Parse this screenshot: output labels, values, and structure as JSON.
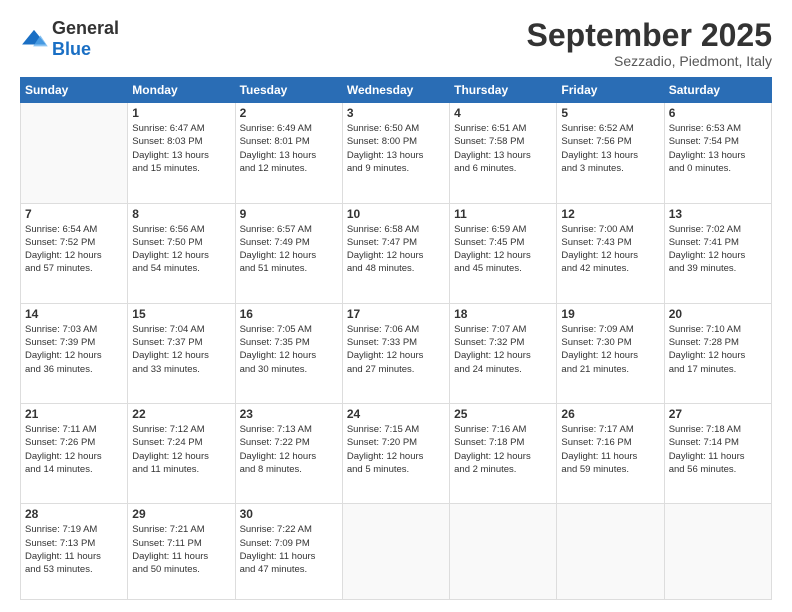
{
  "header": {
    "logo_general": "General",
    "logo_blue": "Blue",
    "month_title": "September 2025",
    "location": "Sezzadio, Piedmont, Italy"
  },
  "days_of_week": [
    "Sunday",
    "Monday",
    "Tuesday",
    "Wednesday",
    "Thursday",
    "Friday",
    "Saturday"
  ],
  "weeks": [
    [
      {
        "day": "",
        "lines": [],
        "empty": true
      },
      {
        "day": "1",
        "lines": [
          "Sunrise: 6:47 AM",
          "Sunset: 8:03 PM",
          "Daylight: 13 hours",
          "and 15 minutes."
        ]
      },
      {
        "day": "2",
        "lines": [
          "Sunrise: 6:49 AM",
          "Sunset: 8:01 PM",
          "Daylight: 13 hours",
          "and 12 minutes."
        ]
      },
      {
        "day": "3",
        "lines": [
          "Sunrise: 6:50 AM",
          "Sunset: 8:00 PM",
          "Daylight: 13 hours",
          "and 9 minutes."
        ]
      },
      {
        "day": "4",
        "lines": [
          "Sunrise: 6:51 AM",
          "Sunset: 7:58 PM",
          "Daylight: 13 hours",
          "and 6 minutes."
        ]
      },
      {
        "day": "5",
        "lines": [
          "Sunrise: 6:52 AM",
          "Sunset: 7:56 PM",
          "Daylight: 13 hours",
          "and 3 minutes."
        ]
      },
      {
        "day": "6",
        "lines": [
          "Sunrise: 6:53 AM",
          "Sunset: 7:54 PM",
          "Daylight: 13 hours",
          "and 0 minutes."
        ]
      }
    ],
    [
      {
        "day": "7",
        "lines": [
          "Sunrise: 6:54 AM",
          "Sunset: 7:52 PM",
          "Daylight: 12 hours",
          "and 57 minutes."
        ]
      },
      {
        "day": "8",
        "lines": [
          "Sunrise: 6:56 AM",
          "Sunset: 7:50 PM",
          "Daylight: 12 hours",
          "and 54 minutes."
        ]
      },
      {
        "day": "9",
        "lines": [
          "Sunrise: 6:57 AM",
          "Sunset: 7:49 PM",
          "Daylight: 12 hours",
          "and 51 minutes."
        ]
      },
      {
        "day": "10",
        "lines": [
          "Sunrise: 6:58 AM",
          "Sunset: 7:47 PM",
          "Daylight: 12 hours",
          "and 48 minutes."
        ]
      },
      {
        "day": "11",
        "lines": [
          "Sunrise: 6:59 AM",
          "Sunset: 7:45 PM",
          "Daylight: 12 hours",
          "and 45 minutes."
        ]
      },
      {
        "day": "12",
        "lines": [
          "Sunrise: 7:00 AM",
          "Sunset: 7:43 PM",
          "Daylight: 12 hours",
          "and 42 minutes."
        ]
      },
      {
        "day": "13",
        "lines": [
          "Sunrise: 7:02 AM",
          "Sunset: 7:41 PM",
          "Daylight: 12 hours",
          "and 39 minutes."
        ]
      }
    ],
    [
      {
        "day": "14",
        "lines": [
          "Sunrise: 7:03 AM",
          "Sunset: 7:39 PM",
          "Daylight: 12 hours",
          "and 36 minutes."
        ]
      },
      {
        "day": "15",
        "lines": [
          "Sunrise: 7:04 AM",
          "Sunset: 7:37 PM",
          "Daylight: 12 hours",
          "and 33 minutes."
        ]
      },
      {
        "day": "16",
        "lines": [
          "Sunrise: 7:05 AM",
          "Sunset: 7:35 PM",
          "Daylight: 12 hours",
          "and 30 minutes."
        ]
      },
      {
        "day": "17",
        "lines": [
          "Sunrise: 7:06 AM",
          "Sunset: 7:33 PM",
          "Daylight: 12 hours",
          "and 27 minutes."
        ]
      },
      {
        "day": "18",
        "lines": [
          "Sunrise: 7:07 AM",
          "Sunset: 7:32 PM",
          "Daylight: 12 hours",
          "and 24 minutes."
        ]
      },
      {
        "day": "19",
        "lines": [
          "Sunrise: 7:09 AM",
          "Sunset: 7:30 PM",
          "Daylight: 12 hours",
          "and 21 minutes."
        ]
      },
      {
        "day": "20",
        "lines": [
          "Sunrise: 7:10 AM",
          "Sunset: 7:28 PM",
          "Daylight: 12 hours",
          "and 17 minutes."
        ]
      }
    ],
    [
      {
        "day": "21",
        "lines": [
          "Sunrise: 7:11 AM",
          "Sunset: 7:26 PM",
          "Daylight: 12 hours",
          "and 14 minutes."
        ]
      },
      {
        "day": "22",
        "lines": [
          "Sunrise: 7:12 AM",
          "Sunset: 7:24 PM",
          "Daylight: 12 hours",
          "and 11 minutes."
        ]
      },
      {
        "day": "23",
        "lines": [
          "Sunrise: 7:13 AM",
          "Sunset: 7:22 PM",
          "Daylight: 12 hours",
          "and 8 minutes."
        ]
      },
      {
        "day": "24",
        "lines": [
          "Sunrise: 7:15 AM",
          "Sunset: 7:20 PM",
          "Daylight: 12 hours",
          "and 5 minutes."
        ]
      },
      {
        "day": "25",
        "lines": [
          "Sunrise: 7:16 AM",
          "Sunset: 7:18 PM",
          "Daylight: 12 hours",
          "and 2 minutes."
        ]
      },
      {
        "day": "26",
        "lines": [
          "Sunrise: 7:17 AM",
          "Sunset: 7:16 PM",
          "Daylight: 11 hours",
          "and 59 minutes."
        ]
      },
      {
        "day": "27",
        "lines": [
          "Sunrise: 7:18 AM",
          "Sunset: 7:14 PM",
          "Daylight: 11 hours",
          "and 56 minutes."
        ]
      }
    ],
    [
      {
        "day": "28",
        "lines": [
          "Sunrise: 7:19 AM",
          "Sunset: 7:13 PM",
          "Daylight: 11 hours",
          "and 53 minutes."
        ]
      },
      {
        "day": "29",
        "lines": [
          "Sunrise: 7:21 AM",
          "Sunset: 7:11 PM",
          "Daylight: 11 hours",
          "and 50 minutes."
        ]
      },
      {
        "day": "30",
        "lines": [
          "Sunrise: 7:22 AM",
          "Sunset: 7:09 PM",
          "Daylight: 11 hours",
          "and 47 minutes."
        ]
      },
      {
        "day": "",
        "lines": [],
        "empty": true
      },
      {
        "day": "",
        "lines": [],
        "empty": true
      },
      {
        "day": "",
        "lines": [],
        "empty": true
      },
      {
        "day": "",
        "lines": [],
        "empty": true
      }
    ]
  ]
}
